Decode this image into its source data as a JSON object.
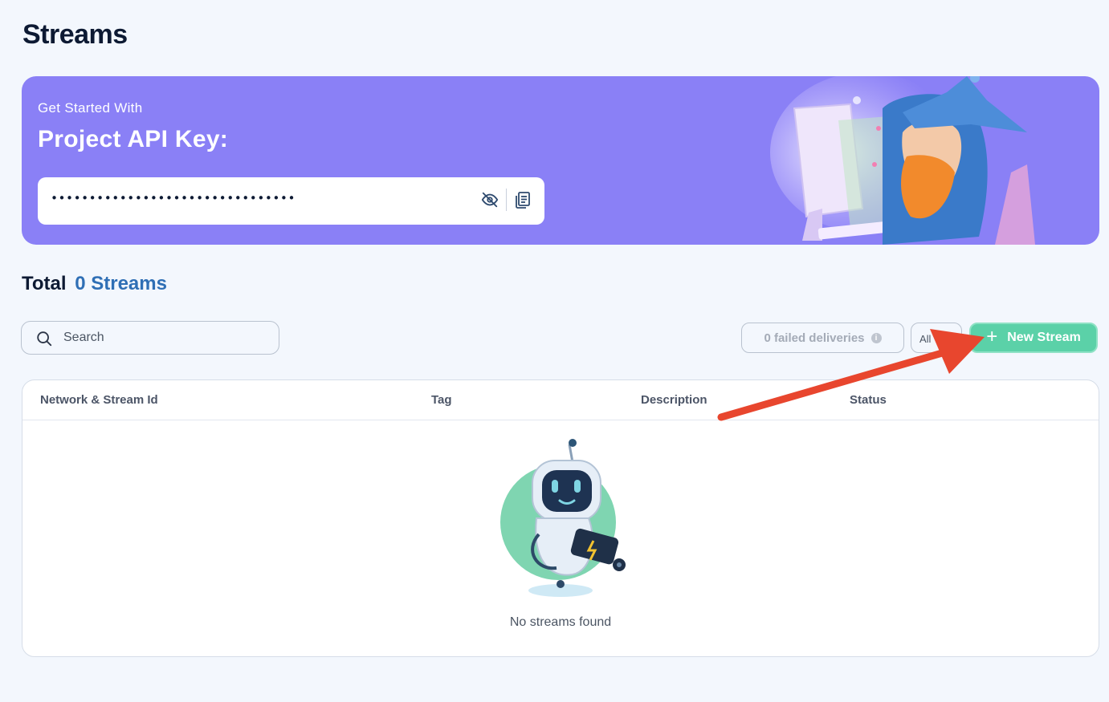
{
  "page": {
    "title": "Streams"
  },
  "banner": {
    "kicker": "Get Started With",
    "title": "Project API Key:",
    "api_key_masked": "••••••••••••••••••••••••••••••••",
    "toggle_icon": "eye-off-icon",
    "copy_icon": "copy-icon",
    "background_color": "#8a80f6"
  },
  "summary": {
    "label": "Total",
    "count": "0 Streams",
    "accent_color": "#2f6fb5"
  },
  "search": {
    "placeholder": "Search",
    "value": ""
  },
  "filters": {
    "failed_deliveries": "0 failed deliveries",
    "status_filter": "All"
  },
  "actions": {
    "new_stream_label": "New Stream",
    "button_color": "#5bd1a8"
  },
  "table": {
    "columns": [
      "Network & Stream Id",
      "Tag",
      "Description",
      "Status"
    ],
    "rows": [],
    "empty_message": "No streams found"
  },
  "annotation": {
    "arrow_color": "#e8462e"
  }
}
